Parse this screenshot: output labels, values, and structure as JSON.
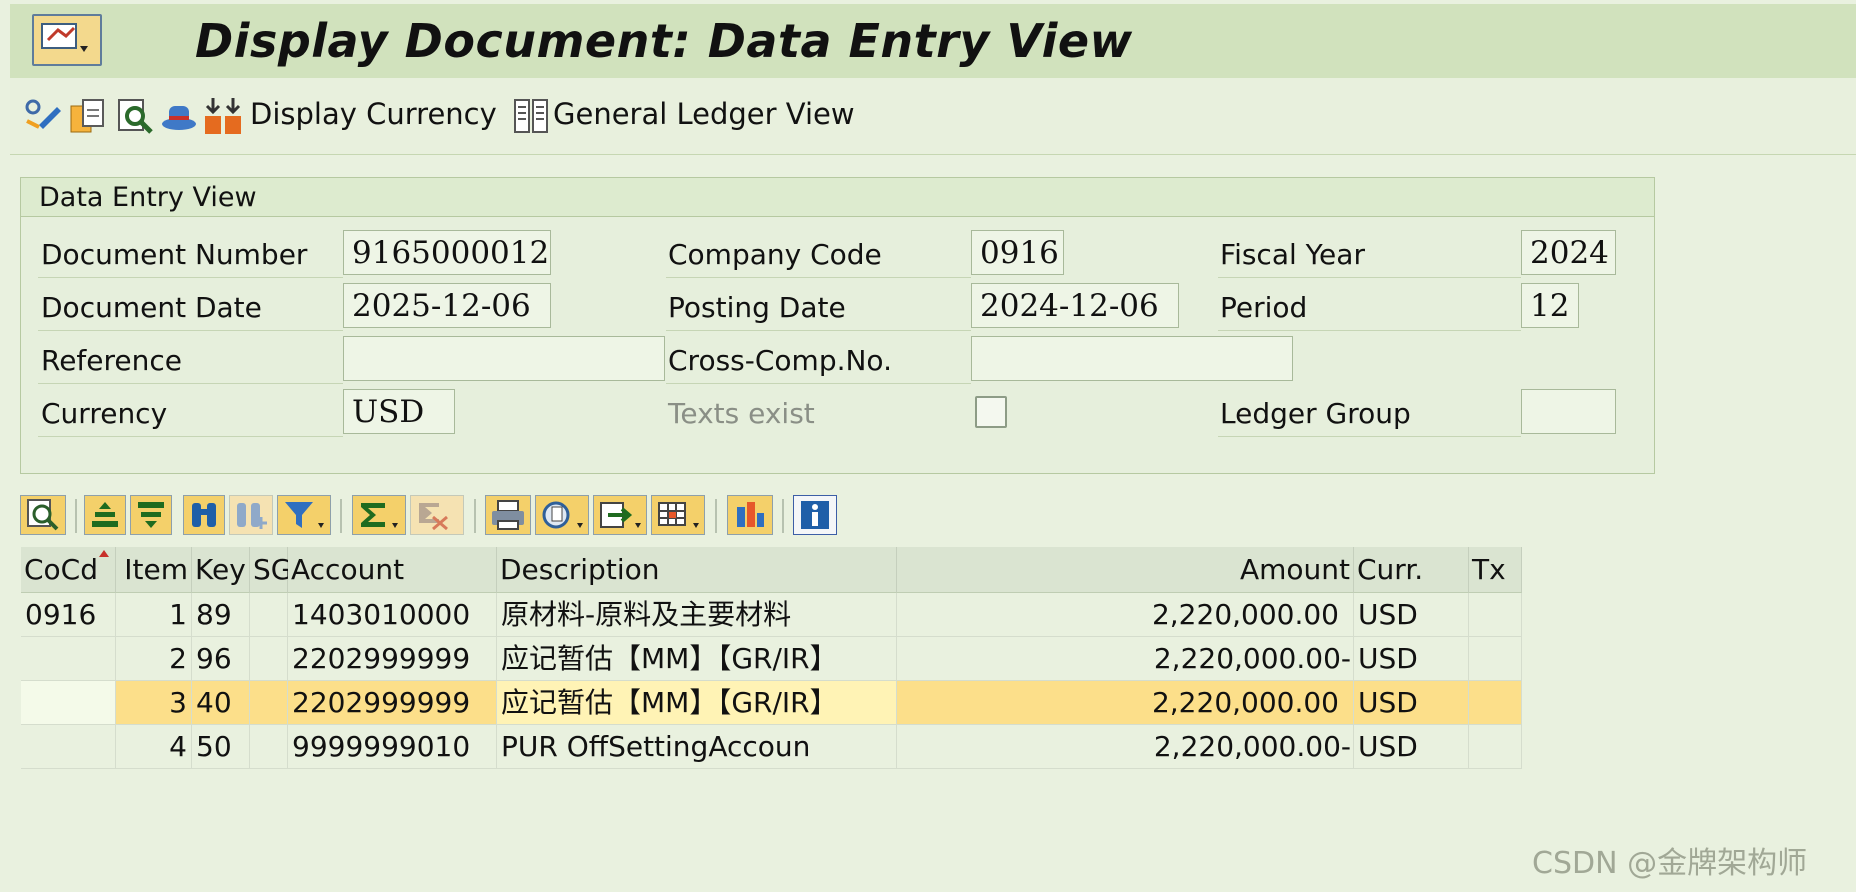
{
  "header": {
    "title": "Display Document: Data Entry View"
  },
  "toolbar": {
    "display_currency": "Display Currency",
    "general_ledger_view": "General Ledger View"
  },
  "panel": {
    "title": "Data Entry View",
    "labels": {
      "document_number": "Document Number",
      "company_code": "Company Code",
      "fiscal_year": "Fiscal Year",
      "document_date": "Document Date",
      "posting_date": "Posting Date",
      "period": "Period",
      "reference": "Reference",
      "cross_comp_no": "Cross-Comp.No.",
      "currency": "Currency",
      "texts_exist": "Texts exist",
      "ledger_group": "Ledger Group"
    },
    "values": {
      "document_number": "9165000012",
      "company_code": "0916",
      "fiscal_year": "2024",
      "document_date": "2025-12-06",
      "posting_date": "2024-12-06",
      "period": "12",
      "reference": "",
      "cross_comp_no": "",
      "currency": "USD",
      "texts_exist": false,
      "ledger_group": ""
    }
  },
  "table": {
    "headers": [
      "CoCd",
      "Item",
      "Key",
      "SG",
      "Account",
      "Description",
      "Amount",
      "Curr.",
      "Tx"
    ],
    "rows": [
      {
        "cocd": "0916",
        "item": "1",
        "key": "89",
        "sg": "",
        "account": "1403010000",
        "description": "原材料-原料及主要材料",
        "amount": "2,220,000.00",
        "curr": "USD",
        "tx": ""
      },
      {
        "cocd": "",
        "item": "2",
        "key": "96",
        "sg": "",
        "account": "2202999999",
        "description": "应记暂估【MM】【GR/IR】",
        "amount": "2,220,000.00-",
        "curr": "USD",
        "tx": ""
      },
      {
        "cocd": "",
        "item": "3",
        "key": "40",
        "sg": "",
        "account": "2202999999",
        "description": "应记暂估【MM】【GR/IR】",
        "amount": "2,220,000.00",
        "curr": "USD",
        "tx": ""
      },
      {
        "cocd": "",
        "item": "4",
        "key": "50",
        "sg": "",
        "account": "9999999010",
        "description": "PUR OffSettingAccoun",
        "amount": "2,220,000.00-",
        "curr": "USD",
        "tx": ""
      }
    ]
  },
  "watermark": "CSDN @金牌架构师",
  "colors": {
    "title_bar": "#d1e2bd",
    "background": "#e9f1df",
    "selected_row": "#fcdf8a"
  }
}
